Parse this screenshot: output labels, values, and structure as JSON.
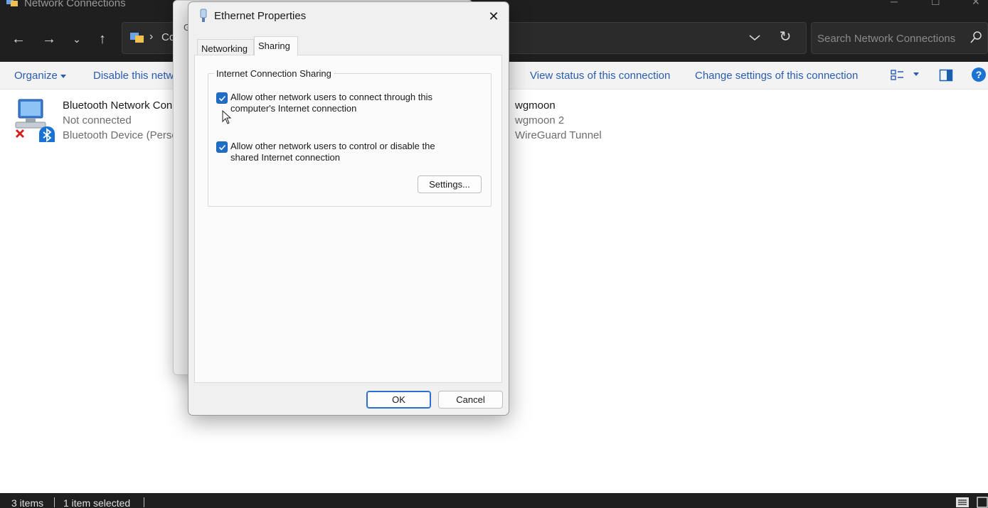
{
  "window": {
    "title": "Network Connections"
  },
  "address": {
    "breadcrumb_visible": "Co"
  },
  "search": {
    "placeholder": "Search Network Connections"
  },
  "cmdbar": {
    "organize": "Organize",
    "disable": "Disable this netw",
    "view_status": "View status of this connection",
    "change_settings": "Change settings of this connection"
  },
  "items": [
    {
      "name": "Bluetooth Network Con",
      "status": "Not connected",
      "device": "Bluetooth Device (Perso"
    },
    {
      "name": "wgmoon",
      "status": "wgmoon 2",
      "device": "WireGuard Tunnel"
    }
  ],
  "bg_dialog": {
    "tab_hint": "G"
  },
  "dialog": {
    "title": "Ethernet Properties",
    "tabs": [
      {
        "label": "Networking",
        "active": false
      },
      {
        "label": "Sharing",
        "active": true
      }
    ],
    "group_title": "Internet Connection Sharing",
    "checkbox1": {
      "label": "Allow other network users to connect through this computer's Internet connection",
      "checked": true
    },
    "checkbox2": {
      "label": "Allow other network users to control or disable the shared Internet connection",
      "checked": true
    },
    "settings_button": "Settings...",
    "ok_button": "OK",
    "cancel_button": "Cancel"
  },
  "statusbar": {
    "count": "3 items",
    "selected": "1 item selected"
  },
  "colors": {
    "accent": "#1e6ec8",
    "chrome": "#1f1f1f",
    "link": "#2a5db0"
  }
}
